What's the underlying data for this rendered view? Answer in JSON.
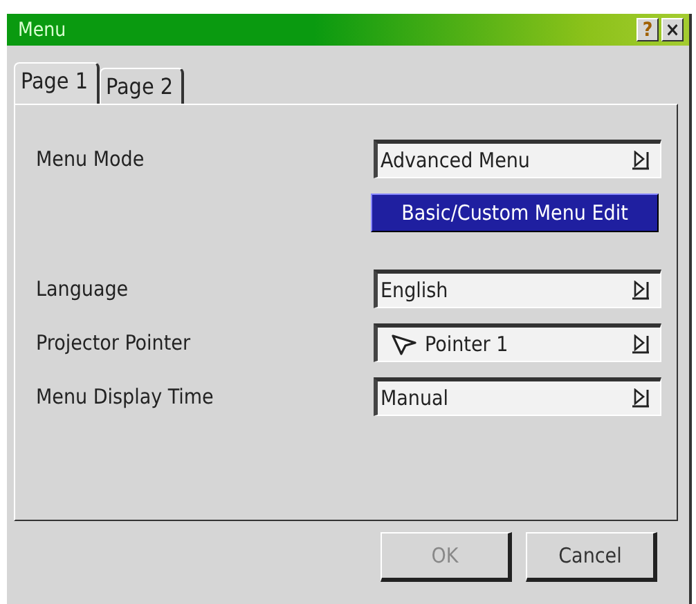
{
  "window": {
    "title": "Menu",
    "help": "?",
    "close": "×"
  },
  "tabs": [
    {
      "label": "Page 1",
      "selected": true
    },
    {
      "label": "Page 2",
      "selected": false
    }
  ],
  "settings": [
    {
      "kind": "select",
      "label": "Menu Mode",
      "value": "Advanced Menu"
    },
    {
      "kind": "button",
      "value": "Basic/Custom Menu Edit"
    },
    {
      "kind": "select",
      "label": "Language",
      "value": "English"
    },
    {
      "kind": "pointer",
      "label": "Projector Pointer",
      "value": "Pointer 1"
    },
    {
      "kind": "select",
      "label": "Menu Display Time",
      "value": "Manual"
    }
  ],
  "buttons": [
    {
      "label": "OK",
      "disabled": true
    },
    {
      "label": "Cancel",
      "disabled": false
    }
  ]
}
